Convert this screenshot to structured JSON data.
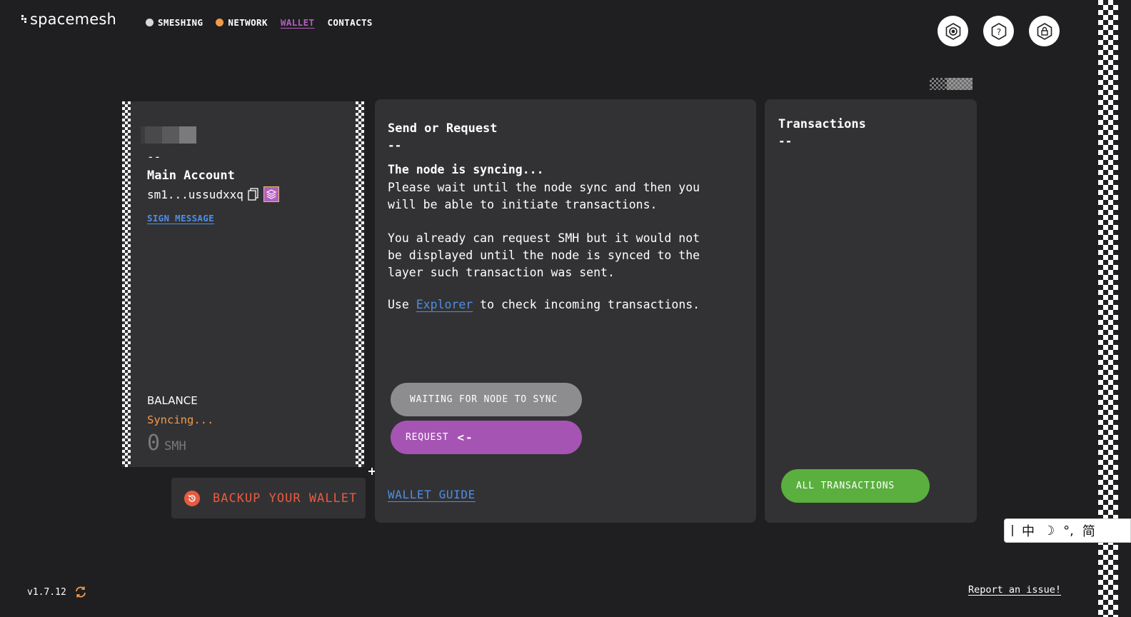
{
  "app": {
    "logo_text": "spacemesh",
    "version": "v1.7.12"
  },
  "nav": {
    "items": [
      {
        "label": "SMESHING",
        "dot_color": "#d9d9d9"
      },
      {
        "label": "NETWORK",
        "dot_color": "#f29a4a"
      },
      {
        "label": "WALLET"
      },
      {
        "label": "CONTACTS"
      }
    ],
    "active": "WALLET"
  },
  "header_icons": [
    "settings-icon",
    "help-icon",
    "lock-icon"
  ],
  "account": {
    "dash": "--",
    "name": "Main Account",
    "address": "sm1...ussudxxq",
    "sign_message": "SIGN MESSAGE",
    "balance_label": "BALANCE",
    "status": "Syncing...",
    "balance_value": "0",
    "balance_unit": "SMH"
  },
  "backup": {
    "label": "BACKUP YOUR WALLET"
  },
  "send": {
    "title": "Send or Request",
    "dash": "--",
    "sync_heading": "The node is syncing...",
    "sync_text": "Please wait until the node sync and then you\nwill be able to initiate transactions.",
    "sync_text2": "You already can request SMH but it would not\nbe displayed until the node is synced to the\nlayer such transaction was sent.",
    "explorer_prefix": "Use ",
    "explorer_link": "Explorer",
    "explorer_suffix": " to check incoming transactions.",
    "wait_button": "WAITING FOR NODE TO SYNC",
    "request_button": "REQUEST",
    "request_arrow": "<-",
    "wallet_guide": "WALLET GUIDE"
  },
  "transactions": {
    "title": "Transactions",
    "dash": "--",
    "all_button": "ALL TRANSACTIONS"
  },
  "ime": {
    "items": [
      "中",
      "☽",
      "°,",
      "简"
    ]
  },
  "footer": {
    "report": "Report an issue!"
  },
  "colors": {
    "background": "#1f1f21",
    "card": "#323234",
    "accent_purple": "#a654b3",
    "link_blue": "#4e8ee6",
    "warning_orange": "#f29a4a",
    "backup_red": "#e85b40",
    "success_green": "#5aaf3e",
    "disabled_grey": "#8d8d8f"
  }
}
